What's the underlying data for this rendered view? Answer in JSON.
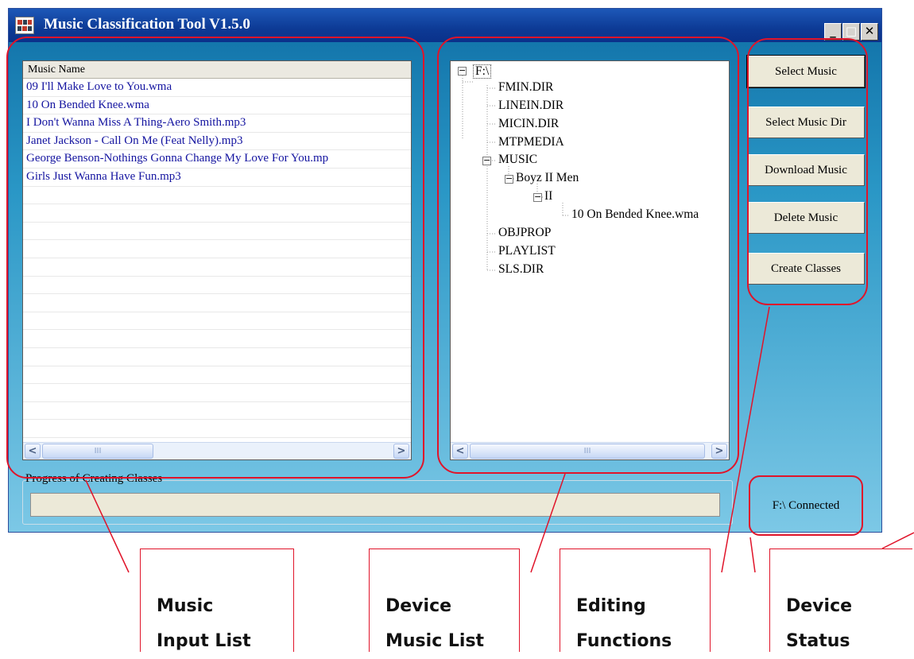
{
  "window": {
    "title": "Music Classification Tool V1.5.0",
    "controls": {
      "minimize": "_",
      "maximize": "□",
      "close": "✕"
    }
  },
  "music_list": {
    "header": "Music Name",
    "items": [
      "09 I'll Make Love to You.wma",
      "10 On Bended Knee.wma",
      "I Don't Wanna Miss A Thing-Aero Smith.mp3",
      "Janet Jackson - Call On Me (Feat Nelly).mp3",
      "George Benson-Nothings Gonna Change My Love For You.mp",
      "Girls Just Wanna Have Fun.mp3"
    ]
  },
  "device_tree": {
    "root": "F:\\",
    "nodes": {
      "fmin": "FMIN.DIR",
      "linein": "LINEIN.DIR",
      "micin": "MICIN.DIR",
      "mtpmedia": "MTPMEDIA",
      "music": "MUSIC",
      "artist": "Boyz II Men",
      "album": "II",
      "track": "10 On Bended Knee.wma",
      "objprop": "OBJPROP",
      "playlist": "PLAYLIST",
      "sls": "SLS.DIR"
    }
  },
  "scrollbar": {
    "left_arrow": "<",
    "right_arrow": ">",
    "thumb_grip": "III"
  },
  "buttons": {
    "select_music": "Select Music",
    "select_music_dir": "Select Music Dir",
    "download_music": "Download Music",
    "delete_music": "Delete Music",
    "create_classes": "Create Classes"
  },
  "progress": {
    "caption": "Progress of Creating Classes",
    "value": 0
  },
  "status": {
    "text": "F:\\ Connected"
  },
  "annotations": {
    "music_input_list": [
      "Music",
      "Input List"
    ],
    "device_music_list": [
      "Device",
      "Music List"
    ],
    "editing_functions": [
      "Editing",
      "Functions"
    ],
    "device_status": [
      "Device",
      "Status"
    ]
  },
  "colors": {
    "callout": "#e0142a",
    "list_text": "#1414a0",
    "title_bar": "#0d3a95"
  }
}
